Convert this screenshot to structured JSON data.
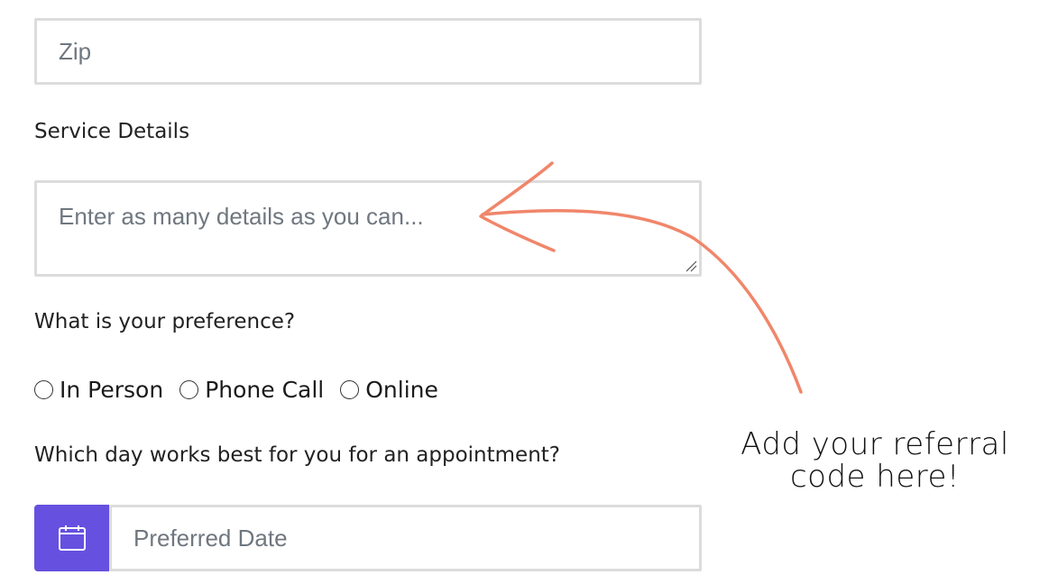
{
  "form": {
    "zip": {
      "placeholder": "Zip",
      "value": ""
    },
    "service_details": {
      "label": "Service Details",
      "placeholder": "Enter as many details as you can...",
      "value": ""
    },
    "preference": {
      "label": "What is your preference?",
      "options": [
        {
          "label": "In Person",
          "selected": false
        },
        {
          "label": "Phone Call",
          "selected": false
        },
        {
          "label": "Online",
          "selected": false
        }
      ]
    },
    "appointment": {
      "label": "Which day works best for you for an appointment?",
      "date_placeholder": "Preferred Date",
      "calendar_icon": "calendar-icon"
    }
  },
  "annotation": {
    "line1": "Add your referral",
    "line2": "code here!",
    "arrow_color": "#f0866a"
  },
  "colors": {
    "accent": "#6650e0",
    "border": "#dcdcdc"
  }
}
